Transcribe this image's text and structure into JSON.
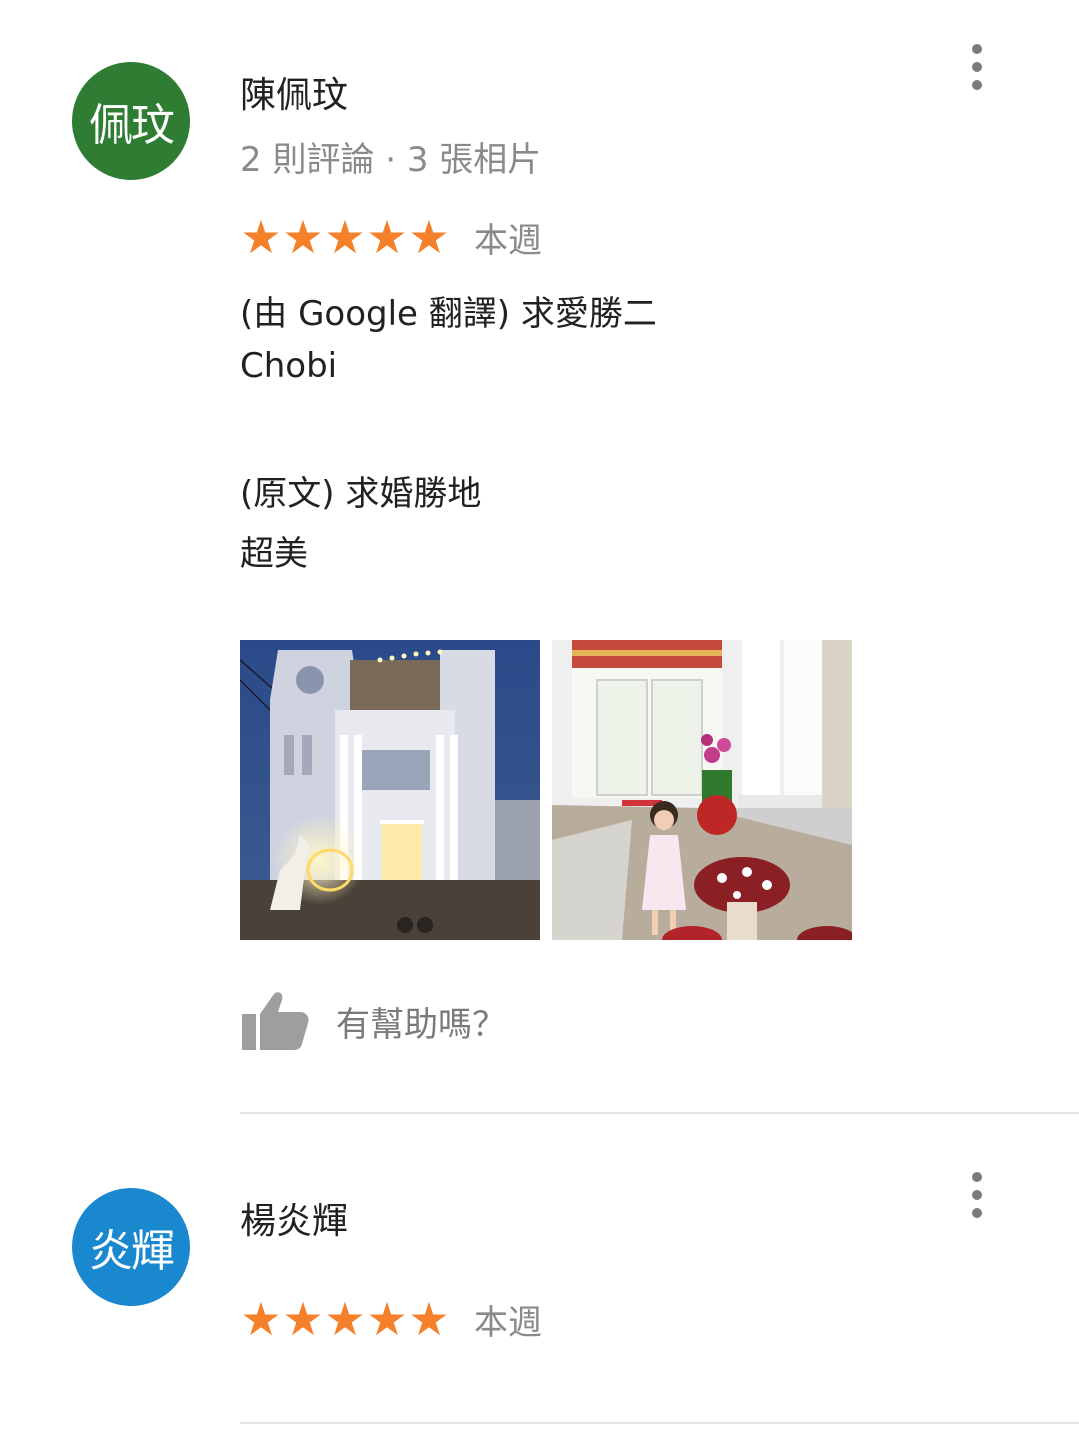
{
  "reviews": [
    {
      "avatar_text": "佩玟",
      "avatar_color": "#2e7d32",
      "name": "陳佩玟",
      "meta": "2 則評論 · 3 張相片",
      "rating": 5,
      "stars": [
        "★",
        "★",
        "★",
        "★",
        "★"
      ],
      "date": "本週",
      "translated_line1": "(由 Google 翻譯) 求愛勝二",
      "translated_line2": "Chobi",
      "original_line1": "(原文) 求婚勝地",
      "original_line2": "超美",
      "photos": [
        {
          "icon": "building-night-photo"
        },
        {
          "icon": "child-entrance-photo"
        }
      ],
      "helpful_label": "有幫助嗎？"
    },
    {
      "avatar_text": "炎輝",
      "avatar_color": "#1a88cf",
      "name": "楊炎輝",
      "rating": 5,
      "stars": [
        "★",
        "★",
        "★",
        "★",
        "★"
      ],
      "date": "本週"
    }
  ],
  "colors": {
    "star": "#f4802a",
    "secondary_text": "#8a8a8a",
    "divider": "#e6e6e6"
  }
}
